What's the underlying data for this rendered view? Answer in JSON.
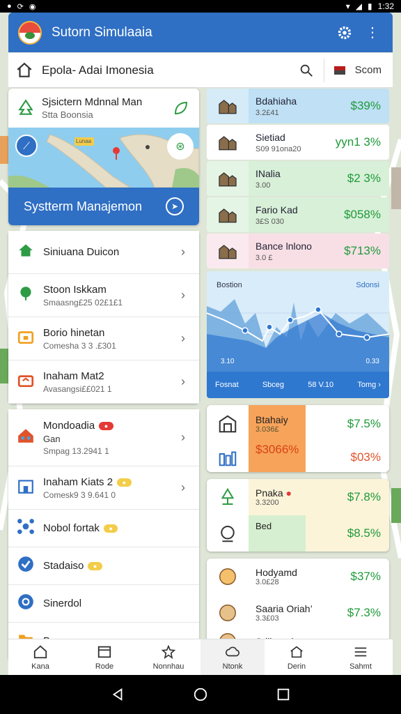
{
  "status_bar": {
    "time": "1:32"
  },
  "app": {
    "title": "Sutorn Simulaaia"
  },
  "search": {
    "text": "Epola- Adai Imonesia",
    "scan_label": "Scom"
  },
  "system_card": {
    "title": "Sjsictern Mdnnal Man",
    "subtitle": "Stta Boonsia",
    "map_tag": "Lunaa",
    "button_label": "Systterm Manajemon"
  },
  "left_list": [
    {
      "title": "Siniuana Duicon",
      "sub": "",
      "icon": "house-icon",
      "color": "#2e9b45"
    },
    {
      "title": "Stoon Iskkam",
      "sub": "Smaasng£25 02£1£1",
      "icon": "tree-icon",
      "color": "#2e9b45"
    },
    {
      "title": "Borio hinetan",
      "sub": "Comesha 3 3 .£301",
      "icon": "shop-icon",
      "color": "#f0a020"
    },
    {
      "title": "Inaham Mat2",
      "sub": "Avasangsi££021 1",
      "icon": "briefcase-icon",
      "color": "#e0532b"
    }
  ],
  "left_list2": [
    {
      "title": "Mondoadia",
      "sub2": "Gan",
      "sub": "Smpag 13.2941 1",
      "icon": "building-icon",
      "color": "#e0532b"
    },
    {
      "title": "Inaham Kiats 2",
      "sub": "Comesk9 3 9.641 0",
      "icon": "store-icon",
      "color": "#2f6fc4"
    },
    {
      "title": "Nobol fortak",
      "sub": "",
      "icon": "network-icon",
      "color": "#2f6fc4"
    },
    {
      "title": "Stadaiso",
      "sub": "",
      "icon": "check-icon",
      "color": "#2f6fc4"
    },
    {
      "title": "Sinerdol",
      "sub": "",
      "icon": "target-icon",
      "color": "#2f6fc4"
    },
    {
      "title": "Buuuao",
      "sub": "",
      "icon": "folder-icon",
      "color": "#f0a020"
    }
  ],
  "stats": [
    {
      "title": "Bdahiaha",
      "sub": "3.2£41",
      "pct": "$39%",
      "bg": "#bfe0f5",
      "icon": "village-icon"
    },
    {
      "title": "Sietiad",
      "sub": "S09 91ona20",
      "pct": "yyn1 3%",
      "bg": "#ffffff",
      "icon": "people-icon"
    },
    {
      "title": "INalia",
      "sub": "3.00",
      "pct": "$2 3%",
      "bg": "#d8f0d8",
      "icon": "houses-icon"
    },
    {
      "title": "Fario Kad",
      "sub": "3£S 030",
      "pct": "$058%",
      "bg": "#d8f0d8",
      "icon": "temple-icon"
    },
    {
      "title": "Bance lnlono",
      "sub": "3.0 £",
      "pct": "$713%",
      "bg": "#f8dfe6",
      "icon": "search-magnifier-icon"
    }
  ],
  "chart": {
    "label_left": "Bostion",
    "label_right": "Sdonsi",
    "x_left": "3.10",
    "x_right": "0.33",
    "footer": [
      "Fosnat",
      "Sbceg",
      "58 V.10",
      "Tomg"
    ]
  },
  "group1": [
    {
      "title": "Btahaiy",
      "sub": "3.036£",
      "pct": "$7.5%",
      "highlight": "$3066%",
      "pct2": "$03%"
    }
  ],
  "group2": [
    {
      "title": "Pnaka",
      "sub": "3.3200",
      "pct": "$7.8%",
      "sub2": "Bed",
      "pct2": "$8.5%"
    }
  ],
  "group3": [
    {
      "title": "Hodyamd",
      "sub": "3.0£28",
      "pct": "$37%"
    },
    {
      "title": "Saaria Oriah’",
      "sub": "3.3£03",
      "pct": "$7.3%"
    },
    {
      "title": "Sdllanad",
      "sub": "",
      "pct": ""
    }
  ],
  "bottom_nav": [
    "Kana",
    "Rode",
    "Nonnhau",
    "Ntonk",
    "Derin",
    "Sahmt"
  ],
  "colors": {
    "primary": "#2f6fc4",
    "green": "#1f9a3a",
    "orange": "#f0a020"
  }
}
